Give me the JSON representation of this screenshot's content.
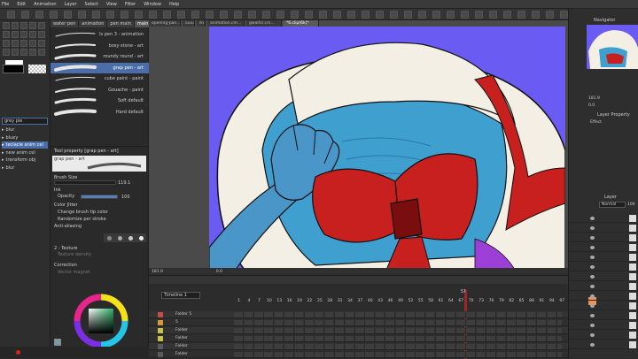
{
  "menu": [
    "File",
    "Edit",
    "Animation",
    "Layer",
    "Select",
    "View",
    "Filter",
    "Window",
    "Help"
  ],
  "canvas_tabs": [
    "opening-pan...",
    "iuuu",
    "iki",
    "animation.cm...",
    "gwaihir.cm...",
    "*6.clip(6k)*"
  ],
  "subtool_tabs": [
    "water pen",
    "animation",
    "pen main",
    "main pen"
  ],
  "brushes": [
    {
      "label": "ls pen 3 - animation",
      "selected": false
    },
    {
      "label": "bosy stone - art",
      "selected": false
    },
    {
      "label": "roundy round - art",
      "selected": false
    },
    {
      "label": "grap pen - art",
      "selected": true
    },
    {
      "label": "cube paint - paint",
      "selected": false
    },
    {
      "label": "Gouache - paint",
      "selected": false
    },
    {
      "label": "Soft default",
      "selected": false
    },
    {
      "label": "Hard default",
      "selected": false
    }
  ],
  "tool_property": {
    "title": "Tool property [grap pen - art]",
    "brush_name": "grap pen - art",
    "brush_size_label": "Brush Size",
    "brush_size_value": "119.1",
    "ink_label": "Ink",
    "opacity_label": "Opacity",
    "opacity_value": "100",
    "color_jitter_label": "Color Jitter",
    "change_tip_label": "Change brush tip color",
    "randomize_label": "Randomize per stroke",
    "anti_alias_label": "Anti-aliasing",
    "texture_label": "2 - Texture",
    "texture_density_label": "Texture density",
    "correction_label": "Correction",
    "vector_magnet_label": "Vector magnet"
  },
  "left_layers": {
    "dropdown_value": "grey pie",
    "items": [
      {
        "label": "blur",
        "selected": false
      },
      {
        "label": "bluey",
        "selected": false
      },
      {
        "label": "teclacie anim cel",
        "selected": true
      },
      {
        "label": "new anim cel",
        "selected": false
      },
      {
        "label": "transform obj",
        "selected": false
      },
      {
        "label": "blur",
        "selected": false
      }
    ]
  },
  "status": {
    "zoom": "181.9",
    "angle": "0.0"
  },
  "color_panel": {
    "coords": "H 127  B 18  S 51"
  },
  "timeline": {
    "name": "Timeline 1",
    "frame_numbers": [
      "1",
      "4",
      "7",
      "10",
      "13",
      "16",
      "19",
      "22",
      "25",
      "28",
      "31",
      "34",
      "37",
      "40",
      "43",
      "46",
      "49",
      "52",
      "55",
      "58",
      "61",
      "64",
      "67",
      "70",
      "73",
      "76",
      "79",
      "82",
      "85",
      "88",
      "91",
      "94",
      "97",
      "100",
      "103"
    ],
    "head_frame": "57",
    "track_names": [
      "Folder 5",
      "5",
      "Folder",
      "Folder",
      "Folder",
      "Folder"
    ]
  },
  "right": {
    "navigator_title": "Navigator",
    "zoom": "181.9",
    "angle": "0.0",
    "layer_property_title": "Layer Property",
    "effect_label": "Effect",
    "layer_title": "Layer",
    "blend_mode": "Normal",
    "opacity": "100"
  },
  "colors": {
    "sky": "#6a5bf2",
    "hat": "#f3efe4",
    "shadow": "#3f9fcf",
    "bow": "#c81f1f",
    "bow_dark": "#7a0e0e",
    "skin": "#4a96c8",
    "accent": "#4b6ea8"
  }
}
